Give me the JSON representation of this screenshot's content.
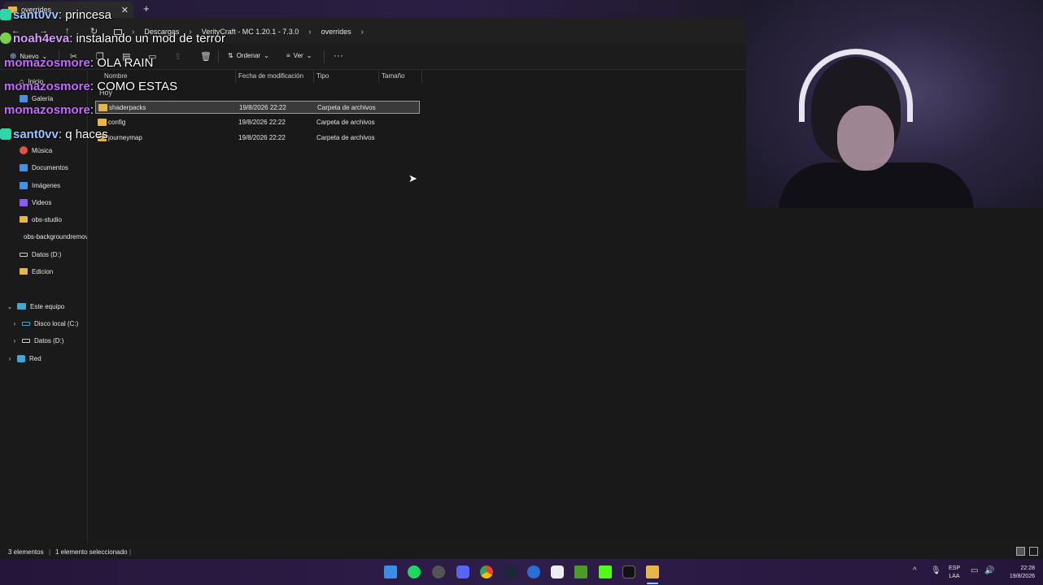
{
  "explorer": {
    "tab_title": "overrides",
    "tab_close": "✕",
    "tab_add": "+",
    "breadcrumbs": [
      "Descargas",
      "VerityCraft - MC 1.20.1 - 7.3.0",
      "overrides"
    ],
    "commands": {
      "new": "Nuevo",
      "sort": "Ordenar",
      "view": "Ver",
      "more": "···"
    },
    "sidebar": {
      "items": [
        {
          "label": "Inicio"
        },
        {
          "label": "Galería"
        },
        {
          "label": "Música"
        },
        {
          "label": "Documentos"
        },
        {
          "label": "Imágenes"
        },
        {
          "label": "Videos"
        },
        {
          "label": "obs-studio"
        },
        {
          "label": "obs-backgroundremoval"
        },
        {
          "label": "Datos (D:)"
        },
        {
          "label": "Edicion"
        }
      ],
      "tree": [
        {
          "label": "Este equipo"
        },
        {
          "label": "Disco local (C:)"
        },
        {
          "label": "Datos (D:)"
        },
        {
          "label": "Red"
        }
      ]
    },
    "columns": [
      "Nombre",
      "Fecha de modificación",
      "Tipo",
      "Tamaño"
    ],
    "group": "Hoy",
    "files": [
      {
        "name": "shaderpacks",
        "date": "19/8/2026 22:22",
        "type": "Carpeta de archivos",
        "selected": true
      },
      {
        "name": "config",
        "date": "19/8/2026 22:22",
        "type": "Carpeta de archivos",
        "selected": false
      },
      {
        "name": "journeymap",
        "date": "19/8/2026 22:22",
        "type": "Carpeta de archivos",
        "selected": false
      }
    ],
    "status": {
      "count": "3 elementos",
      "selection": "1 elemento seleccionado"
    }
  },
  "chat": [
    {
      "user": "sant0vv",
      "message": ": princesa",
      "user_color": "#9ec3ff",
      "badge_color": "#2fd6a8"
    },
    {
      "user": "noah4eva",
      "message": ": instalando un mod de terror",
      "user_color": "#d69cff",
      "badge_color": "#7ad04f"
    },
    {
      "user": "momazosmore",
      "message": ": OLA RAIN",
      "user_color": "#c46bff",
      "badge_color": ""
    },
    {
      "user": "momazosmore",
      "message": ": COMO ESTAS",
      "user_color": "#c46bff",
      "badge_color": ""
    },
    {
      "user": "momazosmore",
      "message": ":",
      "user_color": "#c46bff",
      "badge_color": ""
    },
    {
      "user": "sant0vv",
      "message": ": q haces",
      "user_color": "#9ec3ff",
      "badge_color": "#2fd6a8"
    }
  ],
  "taskbar": {
    "language": "ESP",
    "layout": "LAA",
    "time": "22:28",
    "date": "19/8/2026",
    "apps": [
      "windows-start",
      "spotify",
      "steam-like-app",
      "discord",
      "chrome",
      "steam",
      "edge",
      "capcut",
      "minecraft",
      "kick",
      "tiktok-like-app",
      "file-explorer"
    ]
  },
  "colors": {
    "folder": "#e6b64c",
    "accent": "#9ec3ff"
  }
}
